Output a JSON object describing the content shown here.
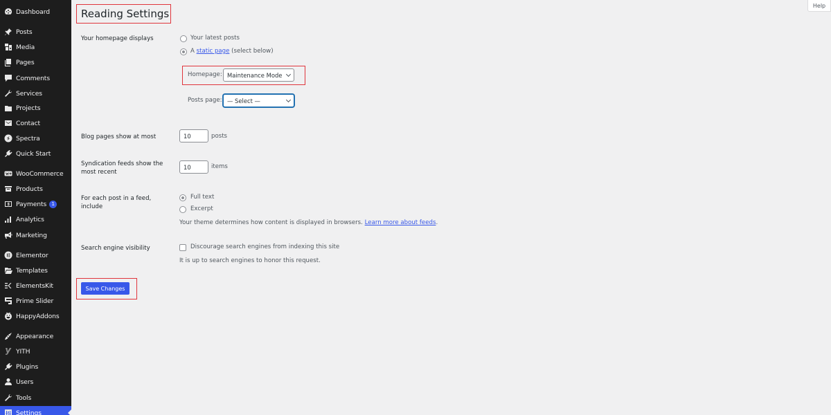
{
  "sidebar": {
    "items": [
      {
        "label": "Dashboard",
        "icon": "dashboard-icon"
      },
      {
        "label": "Posts",
        "icon": "pin-icon"
      },
      {
        "label": "Media",
        "icon": "media-icon"
      },
      {
        "label": "Pages",
        "icon": "pages-icon"
      },
      {
        "label": "Comments",
        "icon": "comment-icon"
      },
      {
        "label": "Services",
        "icon": "wrench-icon"
      },
      {
        "label": "Projects",
        "icon": "folder-icon"
      },
      {
        "label": "Contact",
        "icon": "envelope-icon"
      },
      {
        "label": "Spectra",
        "icon": "spectra-icon"
      },
      {
        "label": "Quick Start",
        "icon": "plug-icon"
      },
      {
        "label": "WooCommerce",
        "icon": "woo-icon"
      },
      {
        "label": "Products",
        "icon": "archive-icon"
      },
      {
        "label": "Payments",
        "icon": "dollar-icon",
        "badge": "1"
      },
      {
        "label": "Analytics",
        "icon": "bar-chart-icon"
      },
      {
        "label": "Marketing",
        "icon": "megaphone-icon"
      },
      {
        "label": "Elementor",
        "icon": "elementor-icon"
      },
      {
        "label": "Templates",
        "icon": "folder-open-icon"
      },
      {
        "label": "ElementsKit",
        "icon": "elementskit-icon"
      },
      {
        "label": "Prime Slider",
        "icon": "prime-slider-icon"
      },
      {
        "label": "HappyAddons",
        "icon": "happy-face-icon"
      },
      {
        "label": "Appearance",
        "icon": "brush-icon"
      },
      {
        "label": "YITH",
        "icon": "yith-icon"
      },
      {
        "label": "Plugins",
        "icon": "plug-icon"
      },
      {
        "label": "Users",
        "icon": "user-icon"
      },
      {
        "label": "Tools",
        "icon": "wrench-icon"
      },
      {
        "label": "Settings",
        "icon": "settings-icon",
        "active": true
      }
    ]
  },
  "help_label": "Help",
  "page_title": "Reading Settings",
  "homepage_displays": {
    "label": "Your homepage displays",
    "option_latest": "Your latest posts",
    "option_static_prefix": "A",
    "option_static_link": "static page",
    "option_static_suffix": "(select below)",
    "selected": "static",
    "homepage_label": "Homepage:",
    "homepage_value": "Maintenance Mode",
    "posts_page_label": "Posts page:",
    "posts_page_value": "— Select —"
  },
  "blog_pages": {
    "label": "Blog pages show at most",
    "value": "10",
    "unit": "posts"
  },
  "syndication": {
    "label": "Syndication feeds show the most recent",
    "value": "10",
    "unit": "items"
  },
  "feed_include": {
    "label": "For each post in a feed, include",
    "option_full": "Full text",
    "option_excerpt": "Excerpt",
    "selected": "full",
    "help_text": "Your theme determines how content is displayed in browsers.",
    "help_link": "Learn more about feeds",
    "help_suffix": "."
  },
  "search_visibility": {
    "label": "Search engine visibility",
    "checkbox_label": "Discourage search engines from indexing this site",
    "checked": false,
    "note": "It is up to search engines to honor this request."
  },
  "save_label": "Save Changes",
  "colors": {
    "sidebar_bg": "#1d1d1d",
    "accent": "#3858e9",
    "highlight_box": "#e0343b",
    "page_bg": "#f0f0f1"
  }
}
